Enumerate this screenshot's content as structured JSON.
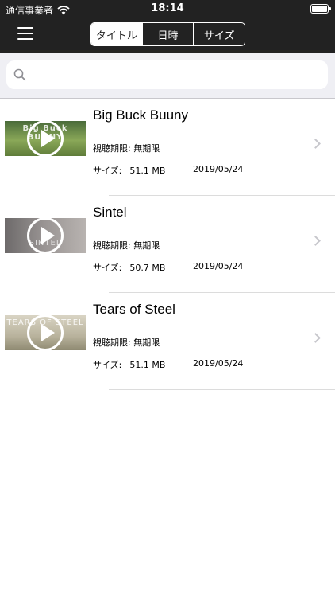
{
  "status": {
    "carrier": "通信事業者",
    "time": "18:14"
  },
  "segments": [
    {
      "label": "タイトル",
      "active": true
    },
    {
      "label": "日時",
      "active": false
    },
    {
      "label": "サイズ",
      "active": false
    }
  ],
  "search": {
    "placeholder": "",
    "value": ""
  },
  "labels": {
    "period": "視聴期限: 無期限",
    "size": "サイズ:"
  },
  "videos": [
    {
      "title": "Big Buck Buuny",
      "period": "視聴期限: 無期限",
      "size_label": "サイズ:",
      "size": "51.1 MB",
      "date": "2019/05/24",
      "thumb_text": "Big Buck BUNNY"
    },
    {
      "title": "Sintel",
      "period": "視聴期限: 無期限",
      "size_label": "サイズ:",
      "size": "50.7 MB",
      "date": "2019/05/24",
      "thumb_text": "SINTEL"
    },
    {
      "title": "Tears of Steel",
      "period": "視聴期限: 無期限",
      "size_label": "サイズ:",
      "size": "51.1 MB",
      "date": "2019/05/24",
      "thumb_text": "TEARS OF STEEL"
    }
  ],
  "colors": {
    "navbar": "#222222",
    "search_bg": "#efeff4",
    "separator": "#dcdcdc",
    "chevron": "#c7c7cc"
  },
  "icons": {
    "menu": "hamburger-icon",
    "search": "magnifier-icon",
    "play": "play-icon",
    "disclosure": "chevron-right-icon",
    "wifi": "wifi-icon",
    "battery": "battery-icon"
  }
}
